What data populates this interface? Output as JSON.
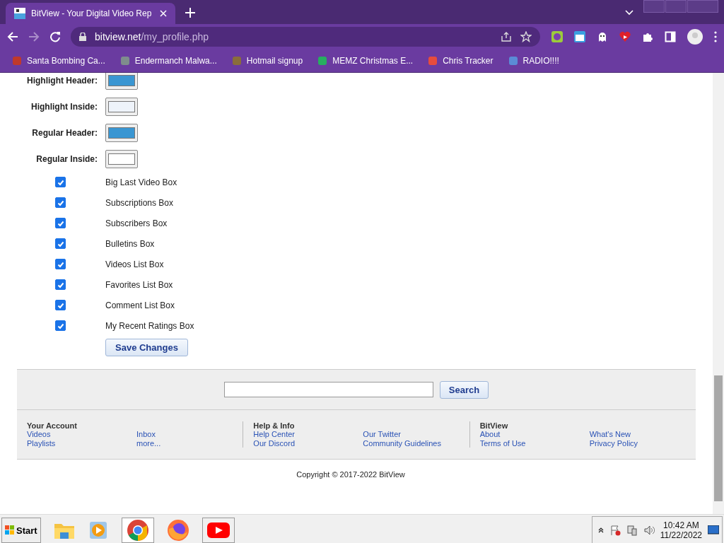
{
  "browser": {
    "tab": {
      "title": "BitView - Your Digital Video Rep",
      "selected": true
    },
    "address": {
      "host": "bitview.net",
      "path": "/my_profile.php"
    },
    "bookmarks": [
      "Santa Bombing Ca...",
      "Endermanch Malwa...",
      "Hotmail signup",
      "MEMZ Christmas E...",
      "Chris Tracker",
      "RADIO!!!!"
    ]
  },
  "color_settings": [
    {
      "label": "Highlight Header:",
      "color": "#3a96d2"
    },
    {
      "label": "Highlight Inside:",
      "color": "#eef3fa"
    },
    {
      "label": "Regular Header:",
      "color": "#3a96d2"
    },
    {
      "label": "Regular Inside:",
      "color": "#ffffff"
    }
  ],
  "boxes": [
    {
      "label": "Big Last Video Box",
      "checked": true
    },
    {
      "label": "Subscriptions Box",
      "checked": true
    },
    {
      "label": "Subscribers Box",
      "checked": true
    },
    {
      "label": "Bulletins Box",
      "checked": true
    },
    {
      "label": "Videos List Box",
      "checked": true
    },
    {
      "label": "Favorites List Box",
      "checked": true
    },
    {
      "label": "Comment List Box",
      "checked": true
    },
    {
      "label": "My Recent Ratings Box",
      "checked": true
    }
  ],
  "save_button": "Save Changes",
  "footer": {
    "search_button": "Search",
    "sections": [
      {
        "heading": "Your Account",
        "links": [
          "Videos",
          "Inbox",
          "Playlists",
          "more..."
        ]
      },
      {
        "heading": "Help & Info",
        "links": [
          "Help Center",
          "Our Twitter",
          "Our Discord",
          "Community Guidelines"
        ]
      },
      {
        "heading": "BitView",
        "links": [
          "About",
          "What's New",
          "Terms of Use",
          "Privacy Policy"
        ]
      }
    ],
    "copyright": "Copyright © 2017-2022 BitView"
  },
  "taskbar": {
    "start": "Start",
    "time": "10:42 AM",
    "date": "11/22/2022"
  }
}
